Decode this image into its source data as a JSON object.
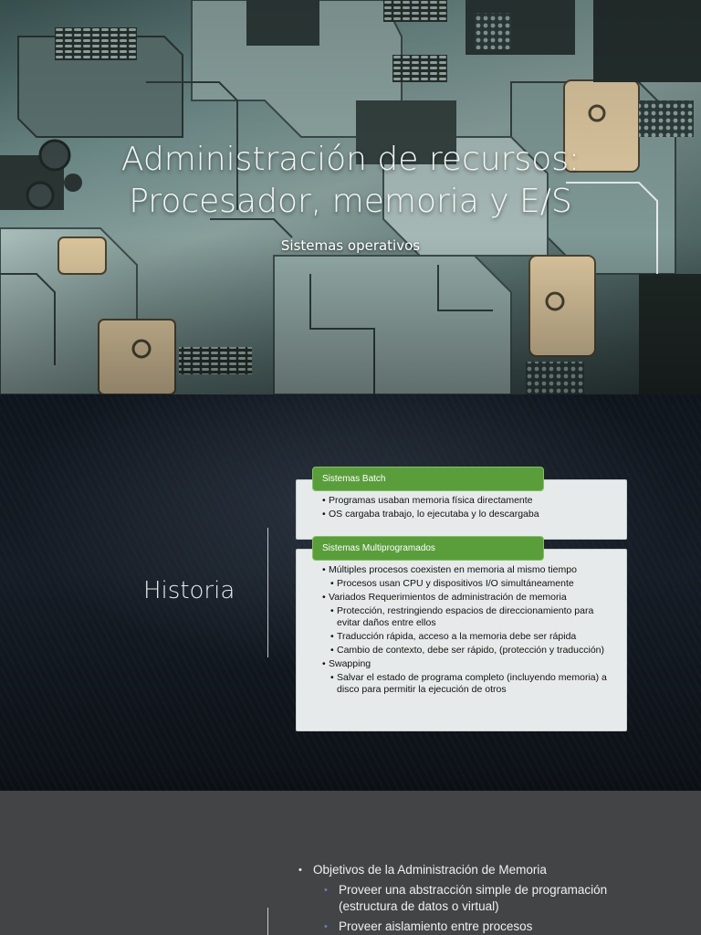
{
  "slide1": {
    "title_line1": "Administración de recursos:",
    "title_line2": "Procesador, memoria y E/S",
    "subtitle": "Sistemas operativos"
  },
  "slide2": {
    "heading": "Historia",
    "groups": [
      {
        "title": "Sistemas Batch",
        "items": [
          {
            "level": 1,
            "text": "Programas usaban memoria física directamente"
          },
          {
            "level": 1,
            "text": "OS cargaba trabajo, lo ejecutaba y lo descargaba"
          }
        ]
      },
      {
        "title": "Sistemas Multiprogramados",
        "items": [
          {
            "level": 1,
            "text": "Múltiples procesos coexisten en memoria al mismo tiempo"
          },
          {
            "level": 2,
            "text": "Procesos usan CPU y dispositivos I/O simultáneamente"
          },
          {
            "level": 1,
            "text": "Variados Requerimientos de administración de memoria"
          },
          {
            "level": 2,
            "text": "Protección, restringiendo espacios de direccionamiento para evitar daños entre ellos"
          },
          {
            "level": 2,
            "text": "Traducción rápida,  acceso a la memoria debe ser rápida"
          },
          {
            "level": 2,
            "text": "Cambio de contexto, debe ser rápido, (protección y traducción)"
          },
          {
            "level": 1,
            "text": "Swapping"
          },
          {
            "level": 2,
            "text": "Salvar el estado de programa completo (incluyendo memoria) a disco para permitir la ejecución de otros"
          }
        ]
      }
    ]
  },
  "slide3": {
    "item": "Objetivos de la Administración de Memoria",
    "subitems": [
      "Proveer una abstracción simple de programación (estructura de datos o virtual)",
      "Proveer aislamiento entre procesos"
    ]
  }
}
